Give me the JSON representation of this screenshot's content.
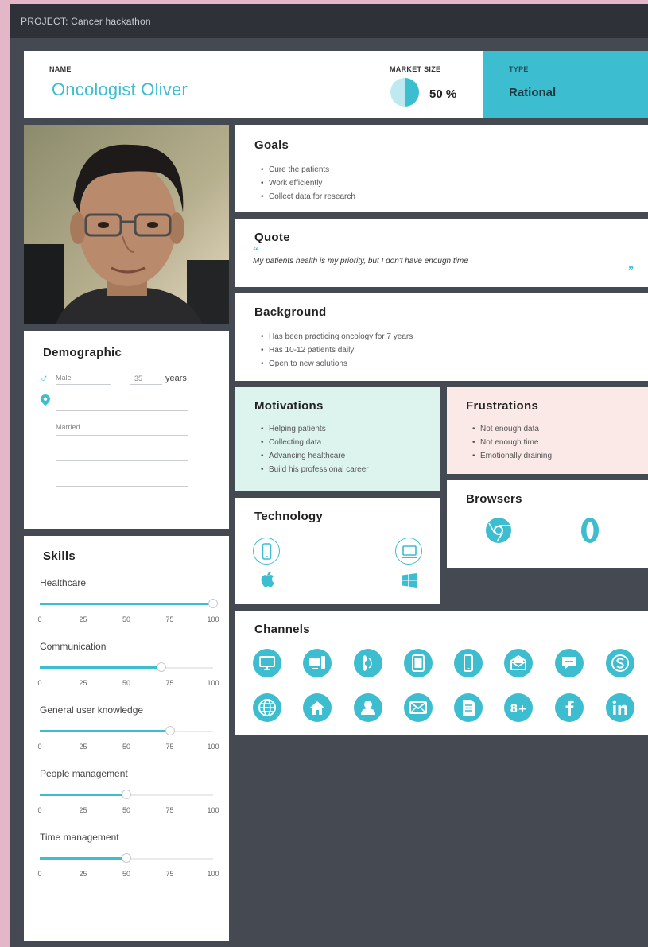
{
  "project_label": "PROJECT: Cancer hackathon",
  "persona": {
    "name_label": "NAME",
    "name": "Oncologist Oliver",
    "market_size_label": "MARKET SIZE",
    "market_size_value": "50 %",
    "market_size_fraction": 0.5,
    "type_label": "TYPE",
    "type_value": "Rational"
  },
  "goals": {
    "title": "Goals",
    "items": [
      "Cure the patients",
      "Work efficiently",
      "Collect data for research"
    ]
  },
  "quote": {
    "title": "Quote",
    "text": "My patients health is my priority, but I don't have enough time"
  },
  "background": {
    "title": "Background",
    "items": [
      "Has been practicing oncology for 7 years",
      "Has 10-12 patients daily",
      "Open to new solutions"
    ]
  },
  "motivations": {
    "title": "Motivations",
    "items": [
      "Helping patients",
      "Collecting data",
      "Advancing healthcare",
      "Build his professional career"
    ]
  },
  "frustrations": {
    "title": "Frustrations",
    "items": [
      "Not enough data",
      "Not enough time",
      "Emotionally draining"
    ]
  },
  "demographic": {
    "title": "Demographic",
    "gender": "Male",
    "age": "35",
    "age_unit": "years",
    "location": "",
    "status": "Married"
  },
  "skills": {
    "title": "Skills",
    "ticks": [
      "0",
      "25",
      "50",
      "75",
      "100"
    ],
    "items": [
      {
        "label": "Healthcare",
        "value": 100
      },
      {
        "label": "Communication",
        "value": 70
      },
      {
        "label": "General user knowledge",
        "value": 75
      },
      {
        "label": "People management",
        "value": 50
      },
      {
        "label": "Time management",
        "value": 50
      }
    ]
  },
  "technology": {
    "title": "Technology",
    "icons": [
      "mobile-icon",
      "apple-icon",
      "laptop-icon",
      "windows-icon"
    ]
  },
  "browsers": {
    "title": "Browsers",
    "icons": [
      "chrome-icon",
      "opera-icon"
    ]
  },
  "channels": {
    "title": "Channels",
    "icons": [
      "desktop-icon",
      "computer-tower-icon",
      "phone-icon",
      "tablet-icon",
      "mobile-icon",
      "mail-open-icon",
      "chat-icon",
      "skype-icon",
      "globe-icon",
      "home-icon",
      "user-icon",
      "envelope-icon",
      "document-icon",
      "google-plus-icon",
      "facebook-icon",
      "linkedin-icon"
    ]
  },
  "colors": {
    "accent": "#3cbdd0",
    "frame": "#454a52",
    "header": "#2e3238",
    "motivations_bg": "#dcf3ee",
    "frustrations_bg": "#fbe9e7",
    "page_bg": "#e3b6c8"
  }
}
